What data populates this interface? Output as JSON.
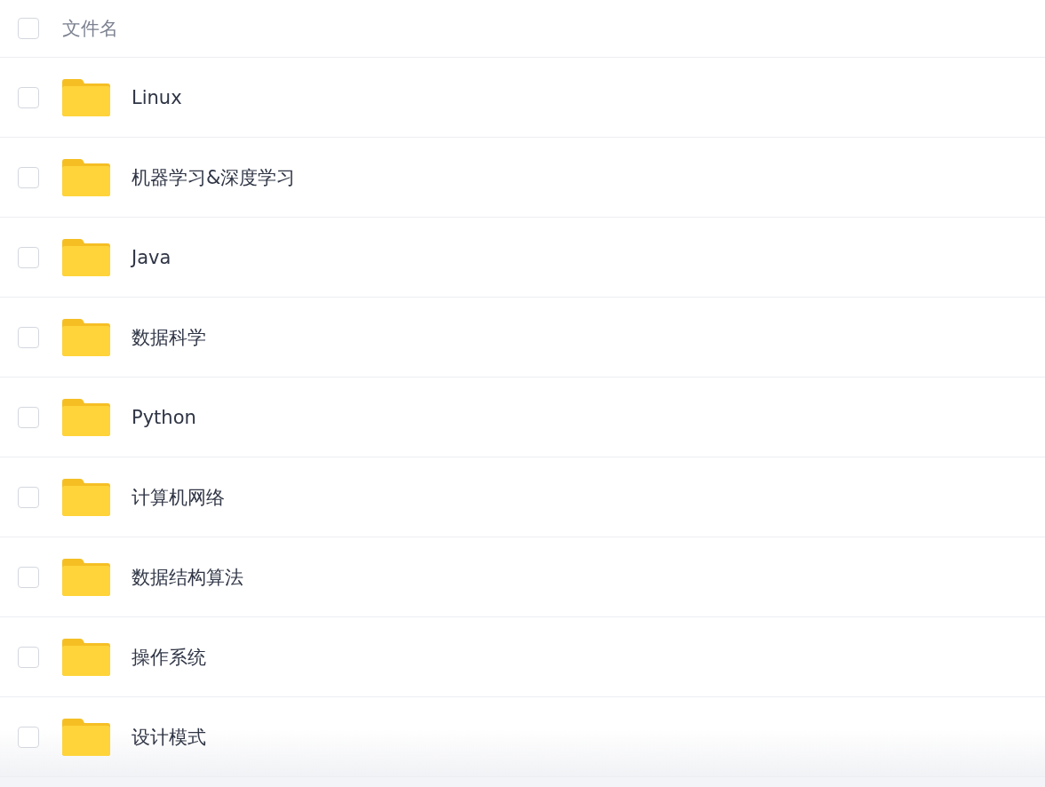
{
  "header": {
    "label": "文件名",
    "checked": false
  },
  "files": [
    {
      "name": "Linux",
      "checked": false
    },
    {
      "name": "机器学习&深度学习",
      "checked": false
    },
    {
      "name": "Java",
      "checked": false
    },
    {
      "name": "数据科学",
      "checked": false
    },
    {
      "name": "Python",
      "checked": false
    },
    {
      "name": "计算机网络",
      "checked": false
    },
    {
      "name": "数据结构算法",
      "checked": false
    },
    {
      "name": "操作系统",
      "checked": false
    },
    {
      "name": "设计模式",
      "checked": false
    }
  ]
}
